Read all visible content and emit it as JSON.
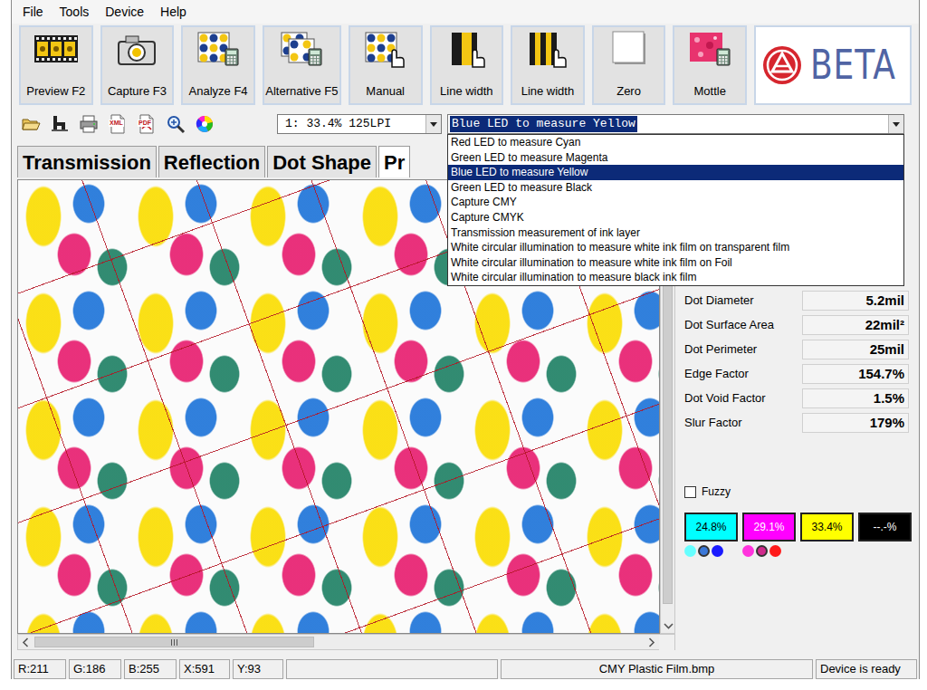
{
  "menu": [
    "File",
    "Tools",
    "Device",
    "Help"
  ],
  "toolbar": [
    {
      "label": "Preview F2"
    },
    {
      "label": "Capture F3"
    },
    {
      "label": "Analyze F4"
    },
    {
      "label": "Alternative F5"
    },
    {
      "label": "Manual"
    },
    {
      "label": "Line width"
    },
    {
      "label": "Line width"
    },
    {
      "label": "Zero"
    },
    {
      "label": "Mottle"
    }
  ],
  "logo": "BETA",
  "export_labels": [
    "XML",
    "PDF"
  ],
  "screen_select": {
    "value": "1: 33.4% 125LPI"
  },
  "mode_select": {
    "value": "Blue LED to measure Yellow",
    "expanded": true,
    "options": [
      {
        "label": "Red LED to measure Cyan",
        "selected": false
      },
      {
        "label": "Green LED to measure Magenta",
        "selected": false
      },
      {
        "label": "Blue LED to measure Yellow",
        "selected": true
      },
      {
        "label": "Green LED to measure Black",
        "selected": false
      },
      {
        "label": "Capture CMY",
        "selected": false
      },
      {
        "label": "Capture CMYK",
        "selected": false
      },
      {
        "label": "Transmission measurement of ink layer",
        "selected": false
      },
      {
        "label": "White circular illumination to measure white ink film on transparent film",
        "selected": false
      },
      {
        "label": "White circular illumination to measure white ink film on Foil",
        "selected": false
      },
      {
        "label": "White circular illumination to measure black ink film",
        "selected": false
      }
    ]
  },
  "tabs": [
    {
      "label": "Transmission",
      "selected": false
    },
    {
      "label": "Reflection",
      "selected": false
    },
    {
      "label": "Dot Shape",
      "selected": false
    },
    {
      "label": "Pr",
      "selected": true
    }
  ],
  "scroll": {
    "h_thumb": 0.46,
    "v_thumb": 0.97
  },
  "metrics": [
    {
      "label": "Dot Diameter",
      "value": "5.2mil"
    },
    {
      "label": "Dot Surface Area",
      "value": "22mil²"
    },
    {
      "label": "Dot Perimeter",
      "value": "25mil"
    },
    {
      "label": "Edge Factor",
      "value": "154.7%"
    },
    {
      "label": "Dot Void Factor",
      "value": "1.5%"
    },
    {
      "label": "Slur Factor",
      "value": "179%"
    }
  ],
  "fuzzy": {
    "label": "Fuzzy",
    "checked": false
  },
  "inks": [
    {
      "value": "24.8%",
      "color": "#00ffff",
      "dots": [
        "#66ffff",
        "#3b78d8",
        "#1a1aff"
      ]
    },
    {
      "value": "29.1%",
      "color": "#ff00ff",
      "dots": [
        "#ff33dd",
        "#d02a8c",
        "#ff1a1a"
      ]
    },
    {
      "value": "33.4%",
      "color": "#ffff00",
      "dots": []
    },
    {
      "value": "--.-%",
      "color": "#000000",
      "dots": []
    }
  ],
  "status_bar": [
    "R:211",
    "G:186",
    "B:255",
    "X:591",
    "Y:93",
    "CMY Plastic Film.bmp",
    "Device is ready"
  ]
}
